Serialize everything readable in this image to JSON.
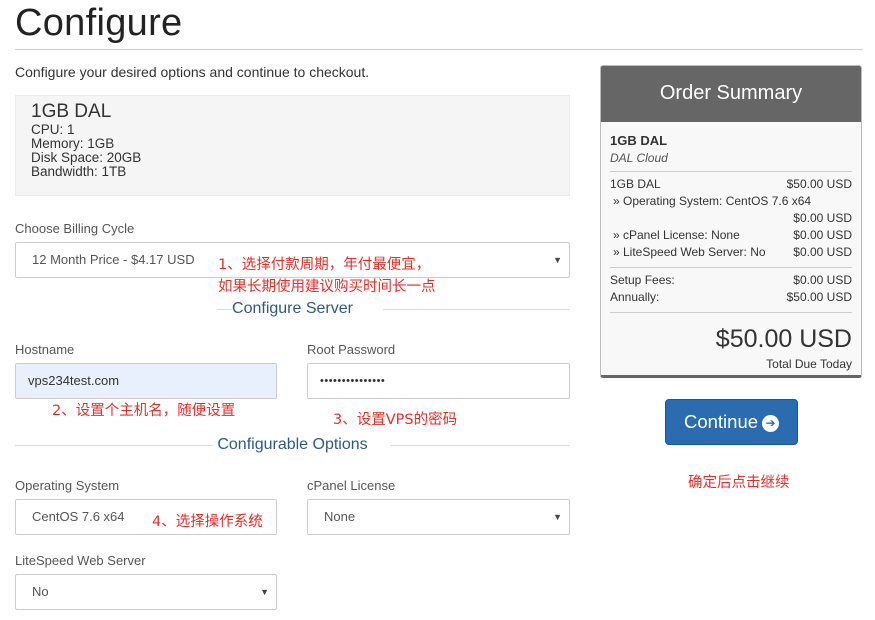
{
  "header": {
    "title": "Configure",
    "intro": "Configure your desired options and continue to checkout."
  },
  "product": {
    "name": "1GB DAL",
    "specs": [
      "CPU: 1",
      "Memory: 1GB",
      "Disk Space: 20GB",
      "Bandwidth: 1TB"
    ]
  },
  "billing": {
    "label": "Choose Billing Cycle",
    "selected": "12 Month Price - $4.17 USD"
  },
  "sections": {
    "configure_server": "Configure Server",
    "configurable_options": "Configurable Options"
  },
  "server": {
    "hostname_label": "Hostname",
    "hostname_value": "vps234test.com",
    "password_label": "Root Password",
    "password_value": "•••••••••••••••"
  },
  "options": {
    "os_label": "Operating System",
    "os_selected": "CentOS 7.6 x64",
    "cpanel_label": "cPanel License",
    "cpanel_selected": "None",
    "litespeed_label": "LiteSpeed Web Server",
    "litespeed_selected": "No"
  },
  "annotations": {
    "note1_line1": "1、选择付款周期，年付最便宜，",
    "note1_line2": "如果长期使用建议购买时间长一点",
    "note2": "2、设置个主机名，随便设置",
    "note3": "3、设置VPS的密码",
    "note4": "4、选择操作系统",
    "note5": "确定后点击继续",
    "color": "#e0302c"
  },
  "summary": {
    "title": "Order Summary",
    "product": "1GB DAL",
    "group": "DAL Cloud",
    "product_line_label": "1GB DAL",
    "product_line_price": "$50.00 USD",
    "os_line_label": "» Operating System: CentOS 7.6 x64",
    "os_line_price": "$0.00 USD",
    "cpanel_line_label": "» cPanel License: None",
    "cpanel_line_price": "$0.00 USD",
    "litespeed_line_label": "» LiteSpeed Web Server: No",
    "litespeed_line_price": "$0.00 USD",
    "setup_label": "Setup Fees:",
    "setup_value": "$0.00 USD",
    "annual_label": "Annually:",
    "annual_value": "$50.00 USD",
    "total": "$50.00 USD",
    "total_label": "Total Due Today"
  },
  "continue_button": {
    "label": "Continue",
    "icon": "arrow-circle-right-icon",
    "color": "#2b6cb0"
  }
}
